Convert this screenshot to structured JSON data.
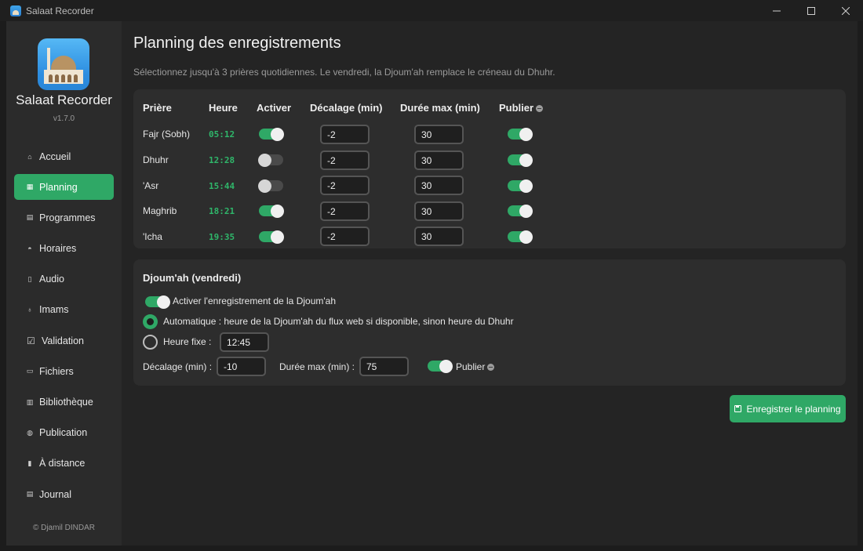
{
  "window": {
    "title": "Salaat Recorder"
  },
  "sidebar": {
    "app_name": "Salaat Recorder",
    "version": "v1.7.0",
    "copyright": "© Djamil DINDAR",
    "items": [
      {
        "label": "Accueil",
        "icon": "home-icon"
      },
      {
        "label": "Planning",
        "icon": "calendar-icon",
        "active": true
      },
      {
        "label": "Programmes",
        "icon": "radio-icon"
      },
      {
        "label": "Horaires",
        "icon": "bell-icon"
      },
      {
        "label": "Audio",
        "icon": "speaker-icon"
      },
      {
        "label": "Imams",
        "icon": "microphone-icon"
      },
      {
        "label": "Validation",
        "icon": "checkbox-icon"
      },
      {
        "label": "Fichiers",
        "icon": "folder-icon"
      },
      {
        "label": "Bibliothèque",
        "icon": "books-icon"
      },
      {
        "label": "Publication",
        "icon": "globe-icon"
      },
      {
        "label": "À distance",
        "icon": "phone-icon"
      },
      {
        "label": "Journal",
        "icon": "document-icon"
      }
    ]
  },
  "page": {
    "title": "Planning des enregistrements",
    "subtitle": "Sélectionnez jusqu'à 3 prières quotidiennes. Le vendredi, la Djoum'ah remplace le créneau du Dhuhr."
  },
  "prayers_table": {
    "headers": {
      "prayer": "Prière",
      "time": "Heure",
      "enable": "Activer",
      "offset": "Décalage (min)",
      "duration": "Durée max (min)",
      "publish": "Publier"
    },
    "rows": [
      {
        "name": "Fajr (Sobh)",
        "time": "05:12",
        "enabled": true,
        "offset": "-2",
        "duration": "30",
        "publish": true
      },
      {
        "name": "Dhuhr",
        "time": "12:28",
        "enabled": false,
        "offset": "-2",
        "duration": "30",
        "publish": true
      },
      {
        "name": "'Asr",
        "time": "15:44",
        "enabled": false,
        "offset": "-2",
        "duration": "30",
        "publish": true
      },
      {
        "name": "Maghrib",
        "time": "18:21",
        "enabled": true,
        "offset": "-2",
        "duration": "30",
        "publish": true
      },
      {
        "name": "'Icha",
        "time": "19:35",
        "enabled": true,
        "offset": "-2",
        "duration": "30",
        "publish": true
      }
    ]
  },
  "jumuah": {
    "title": "Djoum'ah (vendredi)",
    "enable_label": "Activer l'enregistrement de la Djoum'ah",
    "enabled": true,
    "auto_label": "Automatique : heure de la Djoum'ah du flux web si disponible, sinon heure du Dhuhr",
    "auto_selected": true,
    "fixed_label": "Heure fixe :",
    "fixed_value": "12:45",
    "offset_label": "Décalage (min) :",
    "offset_value": "-10",
    "duration_label": "Durée max (min) :",
    "duration_value": "75",
    "publish_label": "Publier",
    "publish": true
  },
  "actions": {
    "save_label": "Enregistrer le planning"
  },
  "colors": {
    "accent": "#2fa866",
    "time_text": "#2fb66a"
  }
}
